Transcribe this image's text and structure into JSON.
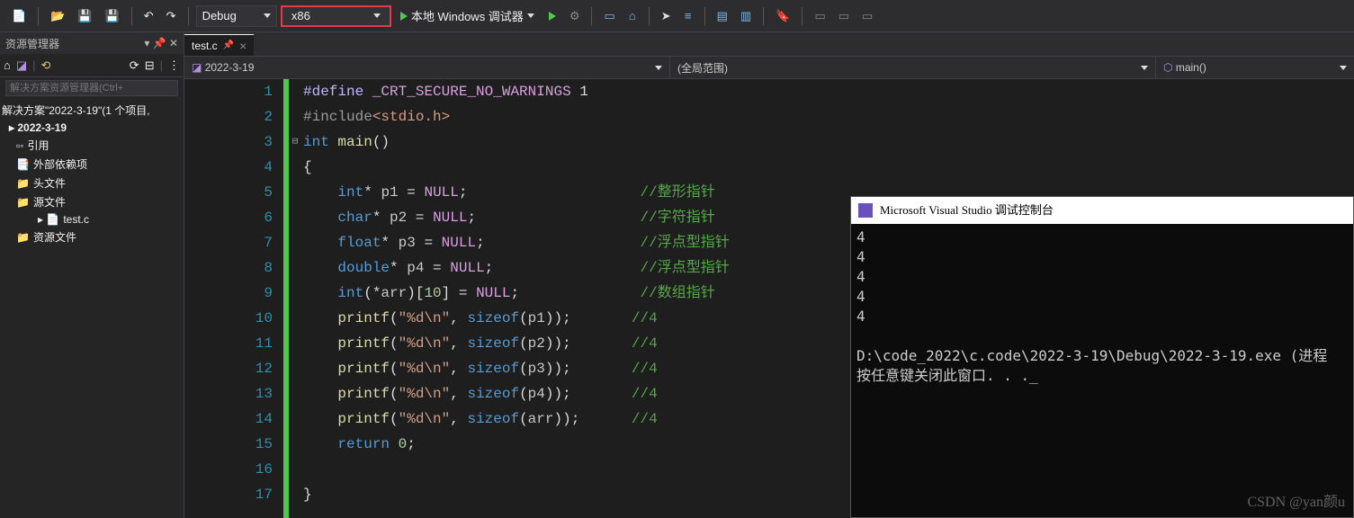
{
  "toolbar": {
    "config_label": "Debug",
    "platform_label": "x86",
    "debugger_label": "本地 Windows 调试器"
  },
  "explorer": {
    "title": "资源管理器",
    "search_placeholder": "解决方案资源管理器(Ctrl+",
    "solution_line": "解决方案\"2022-3-19\"(1 个项目,",
    "project": "2022-3-19",
    "nodes": {
      "references": "引用",
      "external": "外部依赖项",
      "headers": "头文件",
      "sources": "源文件",
      "resources": "资源文件",
      "file": "test.c"
    }
  },
  "tabs": {
    "active_file": "test.c"
  },
  "navbar": {
    "scope1": "2022-3-19",
    "scope2": "(全局范围)",
    "scope3": "main()"
  },
  "code": {
    "lines": [
      {
        "n": 1,
        "html": "<span class='mac'>#define</span> <span class='up'>_CRT_SECURE_NO_WARNINGS</span> <span class='op'>1</span>"
      },
      {
        "n": 2,
        "html": "<span class='inc'>#include</span><span class='incp'>&lt;stdio.h&gt;</span>"
      },
      {
        "n": 3,
        "html": "<span class='kw'>int</span> <span class='fn'>main</span><span class='op'>()</span>",
        "fold": "⊟"
      },
      {
        "n": 4,
        "html": "<span class='op'>{</span>"
      },
      {
        "n": 5,
        "html": "    <span class='kw'>int</span><span class='op'>*</span> <span class='id'>p1</span> <span class='op'>=</span> <span class='up'>NULL</span><span class='op'>;</span>                    <span class='cm'>//整形指针</span>"
      },
      {
        "n": 6,
        "html": "    <span class='kw'>char</span><span class='op'>*</span> <span class='id'>p2</span> <span class='op'>=</span> <span class='up'>NULL</span><span class='op'>;</span>                   <span class='cm'>//字符指针</span>"
      },
      {
        "n": 7,
        "html": "    <span class='kw'>float</span><span class='op'>*</span> <span class='id'>p3</span> <span class='op'>=</span> <span class='up'>NULL</span><span class='op'>;</span>                  <span class='cm'>//浮点型指针</span>"
      },
      {
        "n": 8,
        "html": "    <span class='kw'>double</span><span class='op'>*</span> <span class='id'>p4</span> <span class='op'>=</span> <span class='up'>NULL</span><span class='op'>;</span>                 <span class='cm'>//浮点型指针</span>"
      },
      {
        "n": 9,
        "html": "    <span class='kw'>int</span><span class='op'>(*</span><span class='id'>arr</span><span class='op'>)[</span><span class='num'>10</span><span class='op'>] =</span> <span class='up'>NULL</span><span class='op'>;</span>              <span class='cm'>//数组指针</span>"
      },
      {
        "n": 10,
        "html": "    <span class='fn'>printf</span><span class='op'>(</span><span class='str'>\"%d\\n\"</span><span class='op'>,</span> <span class='kw'>sizeof</span><span class='op'>(</span><span class='id'>p1</span><span class='op'>));</span>       <span class='cm'>//4</span>"
      },
      {
        "n": 11,
        "html": "    <span class='fn'>printf</span><span class='op'>(</span><span class='str'>\"%d\\n\"</span><span class='op'>,</span> <span class='kw'>sizeof</span><span class='op'>(</span><span class='id'>p2</span><span class='op'>));</span>       <span class='cm'>//4</span>"
      },
      {
        "n": 12,
        "html": "    <span class='fn'>printf</span><span class='op'>(</span><span class='str'>\"%d\\n\"</span><span class='op'>,</span> <span class='kw'>sizeof</span><span class='op'>(</span><span class='id'>p3</span><span class='op'>));</span>       <span class='cm'>//4</span>"
      },
      {
        "n": 13,
        "html": "    <span class='fn'>printf</span><span class='op'>(</span><span class='str'>\"%d\\n\"</span><span class='op'>,</span> <span class='kw'>sizeof</span><span class='op'>(</span><span class='id'>p4</span><span class='op'>));</span>       <span class='cm'>//4</span>"
      },
      {
        "n": 14,
        "html": "    <span class='fn'>printf</span><span class='op'>(</span><span class='str'>\"%d\\n\"</span><span class='op'>,</span> <span class='kw'>sizeof</span><span class='op'>(</span><span class='id'>arr</span><span class='op'>));</span>      <span class='cm'>//4</span>"
      },
      {
        "n": 15,
        "html": "    <span class='kw'>return</span> <span class='num'>0</span><span class='op'>;</span>"
      },
      {
        "n": 16,
        "html": ""
      },
      {
        "n": 17,
        "html": "<span class='op'>}</span>"
      }
    ]
  },
  "console": {
    "title": "Microsoft Visual Studio 调试控制台",
    "output": "4\n4\n4\n4\n4\n\nD:\\code_2022\\c.code\\2022-3-19\\Debug\\2022-3-19.exe (进程\n按任意键关闭此窗口. . ._"
  },
  "watermark": "CSDN @yan颜u"
}
